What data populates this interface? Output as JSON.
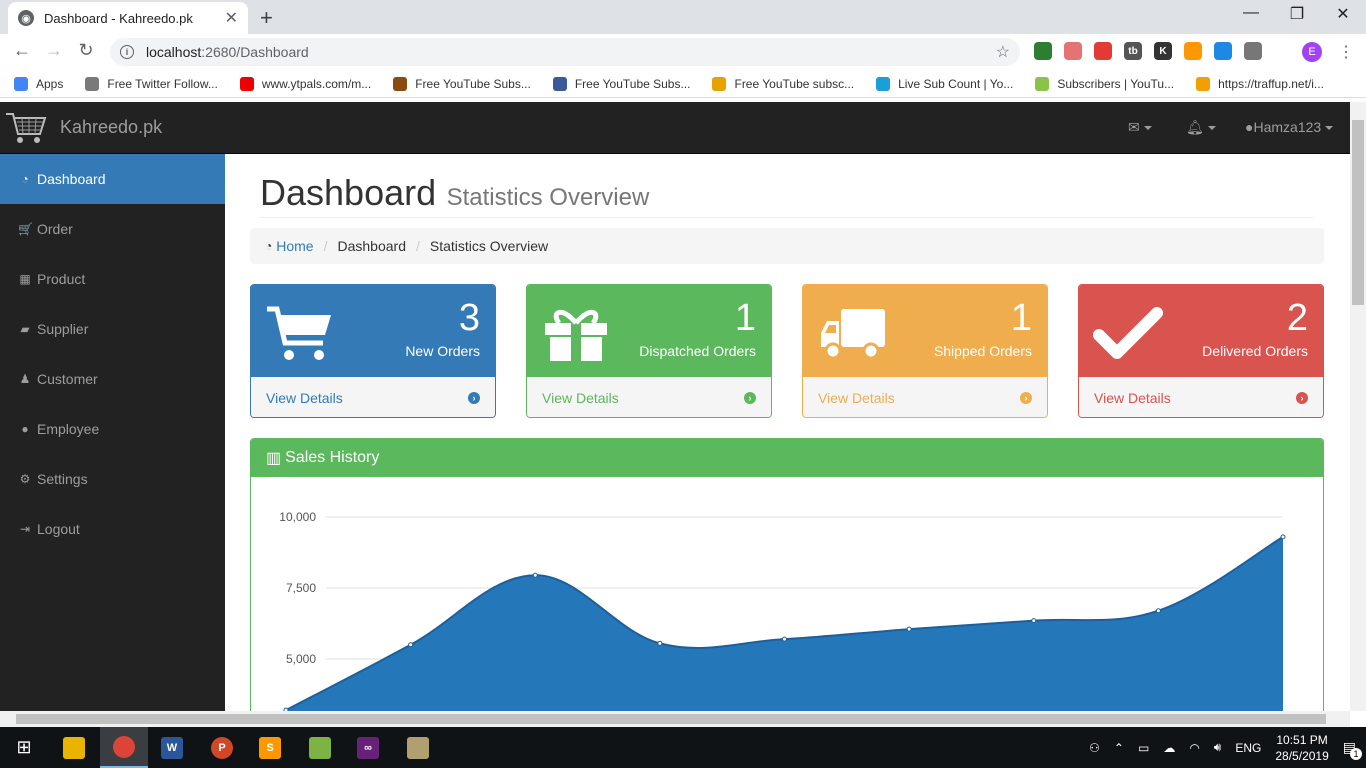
{
  "browser": {
    "tab_title": "Dashboard - Kahreedo.pk",
    "url_host": "localhost",
    "url_path": ":2680/Dashboard",
    "bookmarks": [
      {
        "label": "Apps",
        "icon": "apps-grid-icon",
        "color": "#4285f4"
      },
      {
        "label": "Free Twitter Follow...",
        "icon": "y-icon",
        "color": "#7a7a7a"
      },
      {
        "label": "www.ytpals.com/m...",
        "icon": "ytpals-icon",
        "color": "#e00"
      },
      {
        "label": "Free YouTube Subs...",
        "icon": "face-icon",
        "color": "#8a4b12"
      },
      {
        "label": "Free YouTube Subs...",
        "icon": "thumbs-up-icon",
        "color": "#3b5998"
      },
      {
        "label": "Free YouTube subsc...",
        "icon": "bird-icon",
        "color": "#e8a200"
      },
      {
        "label": "Live Sub Count | Yo...",
        "icon": "s-icon",
        "color": "#1a9fd8"
      },
      {
        "label": "Subscribers | YouTu...",
        "icon": "diamond-icon",
        "color": "#8bc34a"
      },
      {
        "label": "https://traffup.net/i...",
        "icon": "arrow-up-icon",
        "color": "#f0a000"
      }
    ],
    "extensions": [
      {
        "icon": "globe-ext-icon",
        "color": "#2e7d32"
      },
      {
        "icon": "blocker-ext-icon",
        "color": "#e57373"
      },
      {
        "icon": "heart-ext-icon",
        "color": "#e53935"
      },
      {
        "icon": "tb-ext-icon",
        "color": "#555555",
        "text": "tb"
      },
      {
        "icon": "k-ext-icon",
        "color": "#333333",
        "text": "K"
      },
      {
        "icon": "color-ext-icon",
        "color": "#ff9800"
      },
      {
        "icon": "window-ext-icon",
        "color": "#1e88e5"
      },
      {
        "icon": "gear-ext-icon",
        "color": "#777777"
      }
    ],
    "profile_initial": "E"
  },
  "app": {
    "brand": "Kahreedo.pk",
    "user": "Hamza123"
  },
  "sidebar": {
    "items": [
      {
        "label": "Dashboard",
        "icon": "dashboard-icon",
        "glyph": "◔",
        "active": true
      },
      {
        "label": "Order",
        "icon": "cart-icon",
        "glyph": "🛒",
        "active": false
      },
      {
        "label": "Product",
        "icon": "table-icon",
        "glyph": "▦",
        "active": false
      },
      {
        "label": "Supplier",
        "icon": "truck-icon",
        "glyph": "▰",
        "active": false
      },
      {
        "label": "Customer",
        "icon": "person-icon",
        "glyph": "♟",
        "active": false
      },
      {
        "label": "Employee",
        "icon": "user-icon",
        "glyph": "●",
        "active": false
      },
      {
        "label": "Settings",
        "icon": "gear-icon",
        "glyph": "⚙",
        "active": false
      },
      {
        "label": "Logout",
        "icon": "sign-out-icon",
        "glyph": "⇥",
        "active": false
      }
    ]
  },
  "header": {
    "title": "Dashboard",
    "subtitle": "Statistics Overview"
  },
  "breadcrumb": {
    "home": "Home",
    "items": [
      "Dashboard",
      "Statistics Overview"
    ]
  },
  "panels": [
    {
      "count": "3",
      "label": "New Orders",
      "link": "View Details",
      "icon": "cart-icon",
      "color": "#337ab7",
      "border": "#337ab7"
    },
    {
      "count": "1",
      "label": "Dispatched Orders",
      "link": "View Details",
      "icon": "gift-icon",
      "color": "#5cb85c",
      "border": "#5cb85c"
    },
    {
      "count": "1",
      "label": "Shipped Orders",
      "link": "View Details",
      "icon": "truck-icon",
      "color": "#f0ad4e",
      "border": "#f0ad4e"
    },
    {
      "count": "2",
      "label": "Delivered Orders",
      "link": "View Details",
      "icon": "check-icon",
      "color": "#d9534f",
      "border": "#d9534f"
    }
  ],
  "sales": {
    "title": "Sales History"
  },
  "chart_data": {
    "type": "area",
    "title": "Sales History",
    "yticks": [
      5000,
      7500,
      10000
    ],
    "ytick_labels": [
      "5,000",
      "7,500",
      "10,000"
    ],
    "ylim": [
      4000,
      10400
    ],
    "x": [
      0,
      1,
      2,
      3,
      4,
      5,
      6,
      7,
      8
    ],
    "values": [
      3200,
      5500,
      7950,
      5550,
      5700,
      6050,
      6350,
      6700,
      9300
    ],
    "grid": true,
    "fill": "#2477b9",
    "stroke": "#1f5f99"
  },
  "taskbar": {
    "time": "10:51 PM",
    "date": "28/5/2019",
    "lang": "ENG",
    "notifications": "1"
  }
}
